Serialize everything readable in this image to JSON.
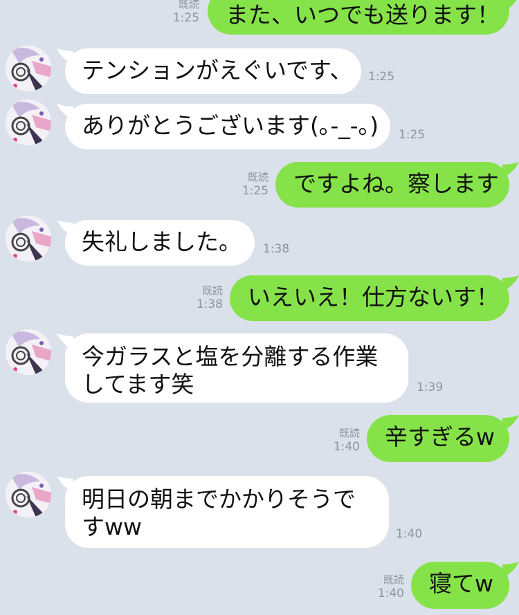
{
  "conversation": {
    "messages": [
      {
        "from": "me",
        "text": "また、いつでも送ります！",
        "read": "既読",
        "time": "1:25"
      },
      {
        "from": "them",
        "text": "テンションがえぐいです、",
        "time": "1:25"
      },
      {
        "from": "them",
        "text": "ありがとうございます(｡-_-｡)",
        "time": "1:25"
      },
      {
        "from": "me",
        "text": "ですよね。察します",
        "read": "既読",
        "time": "1:25"
      },
      {
        "from": "them",
        "text": "失礼しました。",
        "time": "1:38"
      },
      {
        "from": "me",
        "text": "いえいえ！仕方ないす！",
        "read": "既読",
        "time": "1:38"
      },
      {
        "from": "them",
        "text": "今ガラスと塩を分離する作業してます笑",
        "time": "1:39"
      },
      {
        "from": "me",
        "text": "辛すぎるw",
        "read": "既読",
        "time": "1:40"
      },
      {
        "from": "them",
        "text": "明日の朝までかかりそうですww",
        "time": "1:40"
      },
      {
        "from": "me",
        "text": "寝てw",
        "read": "既読",
        "time": "1:40"
      }
    ]
  },
  "theme": {
    "background": "#dbe1ea",
    "outgoing_bubble": "#85e249",
    "incoming_bubble": "#ffffff",
    "meta_text": "#8b93a0"
  },
  "icons": {
    "avatar": "contact-avatar-icon",
    "tail": "bubble-tail-icon"
  }
}
